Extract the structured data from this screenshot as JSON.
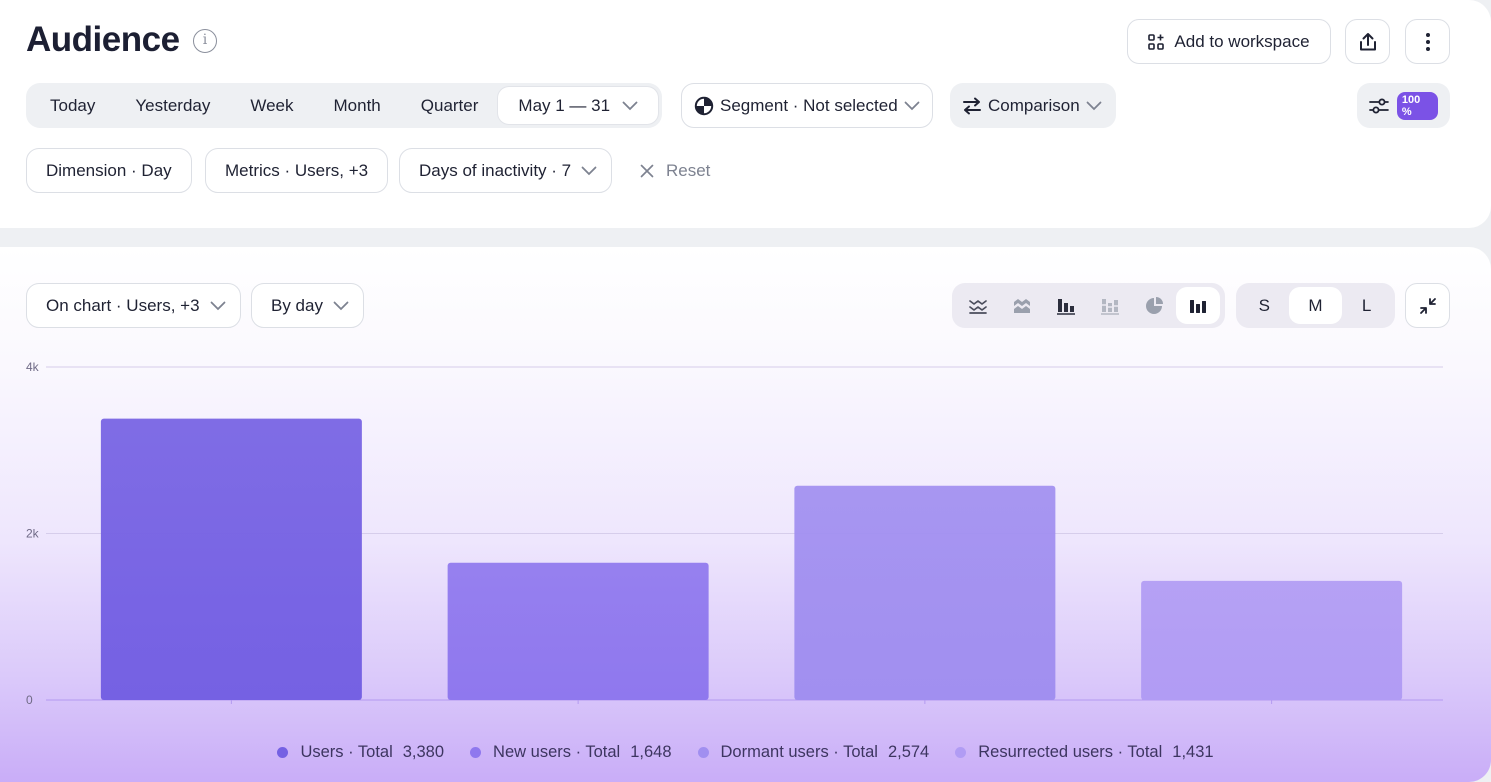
{
  "header": {
    "title": "Audience",
    "info_icon": "info-icon",
    "add_to_workspace_label": "Add to workspace",
    "share_icon": "upload-icon",
    "more_icon": "more-vertical-icon"
  },
  "period": {
    "presets": [
      "Today",
      "Yesterday",
      "Week",
      "Month",
      "Quarter"
    ],
    "selected_range": "May 1 — 31"
  },
  "filters": {
    "segment_label": "Segment · Not selected",
    "comparison_label": "Comparison",
    "sampling_badge": "100 %"
  },
  "report_settings": {
    "dimension_label": "Dimension · Day",
    "metrics_label": "Metrics · Users, +3",
    "inactivity_label": "Days of inactivity · 7",
    "reset_label": "Reset"
  },
  "chart_toolbar": {
    "on_chart_label": "On chart · Users, +3",
    "granularity_label": "By day",
    "chart_type_icons": [
      "line-chart-icon",
      "area-chart-icon",
      "column-chart-icon",
      "stacked-column-icon",
      "pie-chart-icon",
      "bar-chart-icon"
    ],
    "selected_chart_type": "bar-chart-icon",
    "sizes": [
      "S",
      "M",
      "L"
    ],
    "selected_size": "M",
    "collapse_icon": "collapse-icon"
  },
  "colors": {
    "accent": "#7b52e6",
    "series": [
      "#7561e3",
      "#8f78ee",
      "#a18ff0",
      "#b19cf4"
    ]
  },
  "chart_data": {
    "type": "bar",
    "categories": [
      "Users · Total",
      "New users · Total",
      "Dormant users · Total",
      "Resurrected users · Total"
    ],
    "values": [
      3380,
      1648,
      2574,
      1431
    ],
    "value_labels": [
      "3,380",
      "1,648",
      "2,574",
      "1,431"
    ],
    "ylim": [
      0,
      4000
    ],
    "yticks": [
      0,
      2000,
      4000
    ],
    "ytick_labels": [
      "0",
      "2k",
      "4k"
    ],
    "grid": true,
    "legend_position": "bottom"
  }
}
